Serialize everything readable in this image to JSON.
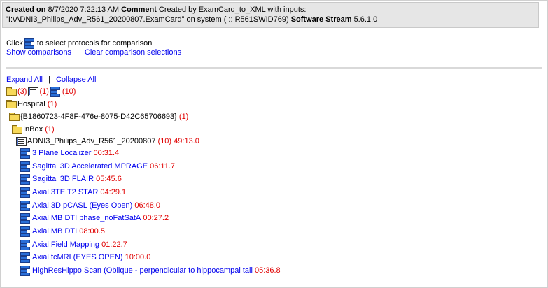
{
  "header": {
    "created_label": "Created on",
    "created_value": "8/7/2020 7:22:13 AM",
    "comment_label": "Comment",
    "comment_value": "Created by ExamCard_to_XML with inputs:",
    "line2_value": "\"I:\\ADNI3_Philips_Adv_R561_20200807.ExamCard\" on system ( :: R561SWID769)",
    "stream_label": "Software Stream",
    "stream_value": "5.6.1.0"
  },
  "compare": {
    "click_text": "Click",
    "instruction": "to select protocols for comparison",
    "show_link": "Show comparisons",
    "separator": "|",
    "clear_link": "Clear comparison selections"
  },
  "expand": {
    "expand_all": "Expand All",
    "separator": "|",
    "collapse_all": "Collapse All"
  },
  "summary": {
    "folder_count": "(3)",
    "examcard_count": "(1)",
    "protocol_count": "(10)"
  },
  "tree": {
    "hospital": {
      "label": "Hospital",
      "count": "(1)"
    },
    "guid": {
      "label": "{B1860723-4F8F-476e-8075-D42C65706693}",
      "count": "(1)"
    },
    "inbox": {
      "label": "InBox",
      "count": "(1)"
    },
    "examcard": {
      "label": "ADNI3_Philips_Adv_R561_20200807",
      "count": "(10)",
      "duration": "49:13.0"
    },
    "protocols": [
      {
        "name": "3 Plane Localizer",
        "duration": "00:31.4"
      },
      {
        "name": "Sagittal 3D Accelerated MPRAGE",
        "duration": "06:11.7"
      },
      {
        "name": "Sagittal 3D FLAIR",
        "duration": "05:45.6"
      },
      {
        "name": "Axial 3TE T2 STAR",
        "duration": "04:29.1"
      },
      {
        "name": "Axial 3D pCASL (Eyes Open)",
        "duration": "06:48.0"
      },
      {
        "name": "Axial MB DTI phase_noFatSatA",
        "duration": "00:27.2"
      },
      {
        "name": "Axial MB DTI",
        "duration": "08:00.5"
      },
      {
        "name": "Axial Field Mapping",
        "duration": "01:22.7"
      },
      {
        "name": "Axial fcMRI (EYES OPEN)",
        "duration": "10:00.0"
      },
      {
        "name": "HighResHippo Scan (Oblique - perpendicular to hippocampal tail",
        "duration": "05:36.8"
      }
    ]
  },
  "icons": [
    "folder-icon",
    "examcard-icon",
    "protocol-icon"
  ]
}
